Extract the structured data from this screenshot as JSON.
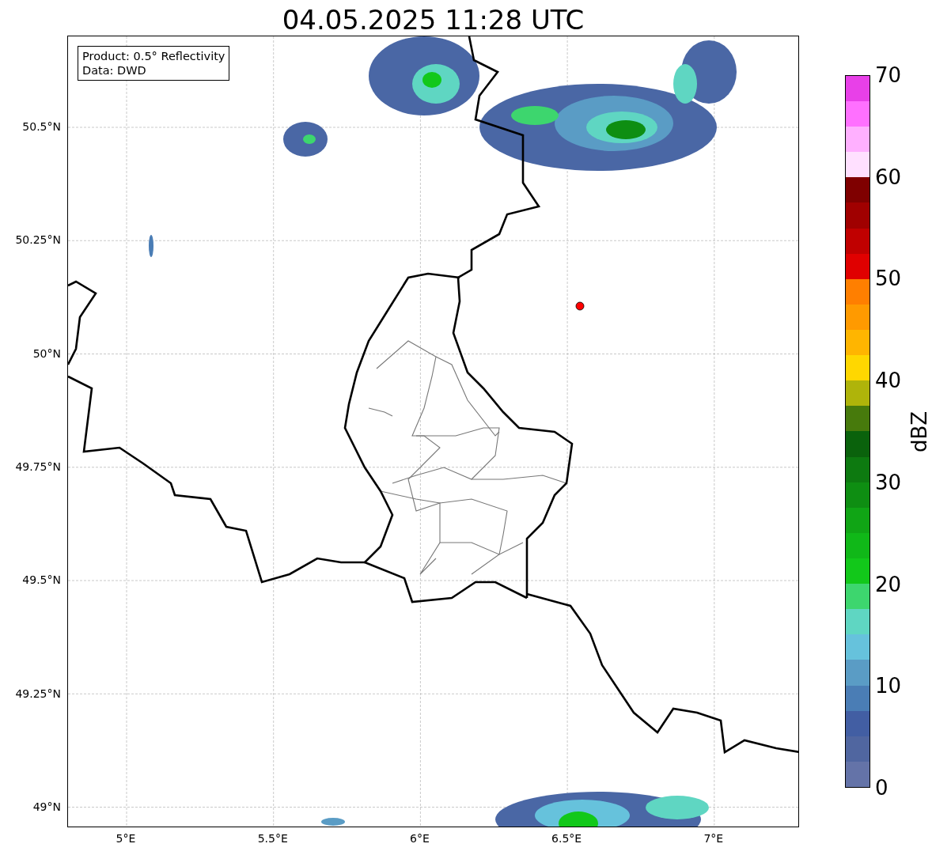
{
  "title": "04.05.2025 11:28 UTC",
  "info_box": {
    "lines": [
      "Product: 0.5° Reflectivity",
      "Data: DWD"
    ]
  },
  "lat_ticks": [
    "50.5°N",
    "50.25°N",
    "50°N",
    "49.75°N",
    "49.5°N",
    "49.25°N",
    "49°N"
  ],
  "lon_ticks": [
    "5°E",
    "5.5°E",
    "6°E",
    "6.5°E",
    "7°E"
  ],
  "colorbar": {
    "label": "dBZ",
    "ticks": [
      "70",
      "60",
      "50",
      "40",
      "30",
      "20",
      "10",
      "0"
    ],
    "bins": [
      {
        "color": "#6473a8"
      },
      {
        "color": "#5066a0"
      },
      {
        "color": "#425ea3"
      },
      {
        "color": "#4a7db5"
      },
      {
        "color": "#5a9cc5"
      },
      {
        "color": "#66c2dc"
      },
      {
        "color": "#5fd6c2"
      },
      {
        "color": "#3dd66e"
      },
      {
        "color": "#12c81a"
      },
      {
        "color": "#10b818"
      },
      {
        "color": "#10a515"
      },
      {
        "color": "#0e8e12"
      },
      {
        "color": "#0d7a10"
      },
      {
        "color": "#0a620c"
      },
      {
        "color": "#477a0c"
      },
      {
        "color": "#afb40a"
      },
      {
        "color": "#ffd700"
      },
      {
        "color": "#ffb500"
      },
      {
        "color": "#ff9a00"
      },
      {
        "color": "#ff7f00"
      },
      {
        "color": "#e00000"
      },
      {
        "color": "#c00000"
      },
      {
        "color": "#a00000"
      },
      {
        "color": "#7f0000"
      },
      {
        "color": "#ffe0ff"
      },
      {
        "color": "#ffb0ff"
      },
      {
        "color": "#ff70ff"
      },
      {
        "color": "#e840e8"
      }
    ]
  }
}
